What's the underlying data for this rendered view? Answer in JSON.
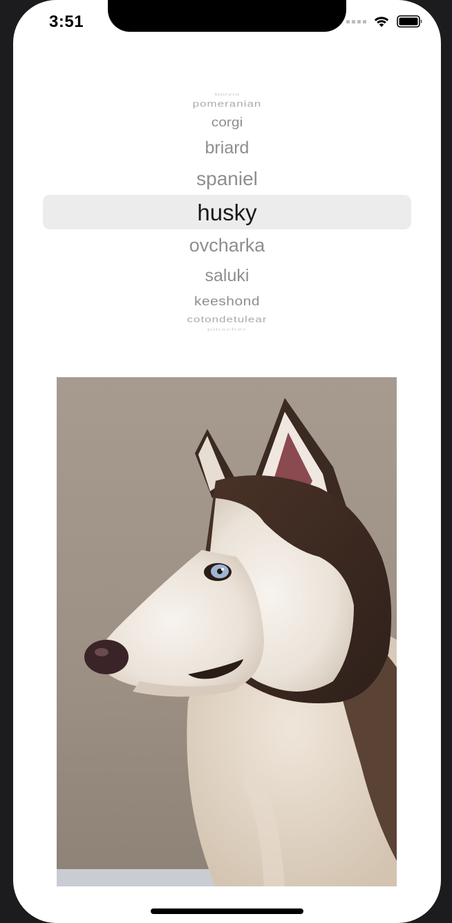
{
  "status_bar": {
    "time": "3:51",
    "icons": [
      "cellular-signal-icon",
      "wifi-icon",
      "battery-icon"
    ]
  },
  "breed_picker": {
    "selected": "husky",
    "items": [
      {
        "label": "borzoi"
      },
      {
        "label": "pomeranian"
      },
      {
        "label": "corgi"
      },
      {
        "label": "briard"
      },
      {
        "label": "spaniel"
      },
      {
        "label": "husky"
      },
      {
        "label": "ovcharka"
      },
      {
        "label": "saluki"
      },
      {
        "label": "keeshond"
      },
      {
        "label": "cotondetulear"
      },
      {
        "label": "pinscher"
      }
    ]
  },
  "breed_image": {
    "subject": "husky"
  },
  "colors": {
    "picker_selected_text": "#1a1a1a",
    "picker_text": "#8e8e8e",
    "picker_highlight": "#ececec",
    "background": "#ffffff"
  }
}
